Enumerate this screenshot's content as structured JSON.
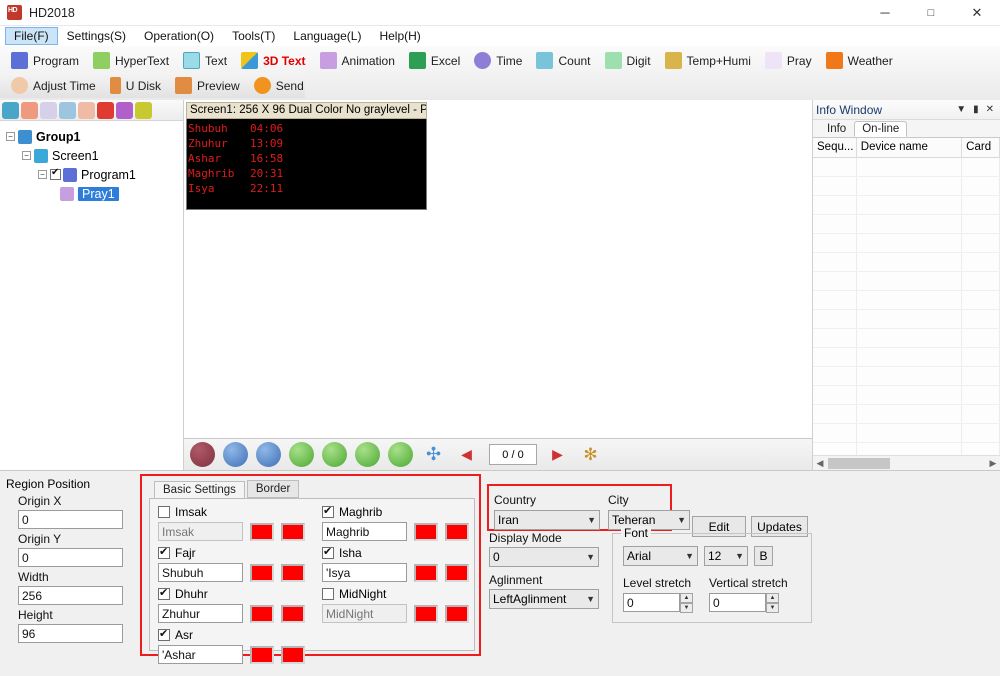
{
  "window": {
    "title": "HD2018",
    "icon": "hd-app-icon",
    "controls": {
      "minimize": "─",
      "maximize": "□",
      "close": "✕"
    }
  },
  "menubar": {
    "items": [
      {
        "label": "File(F)",
        "active": true
      },
      {
        "label": "Settings(S)",
        "active": false
      },
      {
        "label": "Operation(O)",
        "active": false
      },
      {
        "label": "Tools(T)",
        "active": false
      },
      {
        "label": "Language(L)",
        "active": false
      },
      {
        "label": "Help(H)",
        "active": false
      }
    ]
  },
  "ribbon": {
    "row1": [
      {
        "label": "Program",
        "icon": "program-icon",
        "color": "#5b6fd6",
        "red": false
      },
      {
        "label": "HyperText",
        "icon": "hypertext-icon",
        "color": "#8fcf62",
        "red": false
      },
      {
        "label": "Text",
        "icon": "text-icon",
        "color": "#4fc3d9",
        "red": false
      },
      {
        "label": "3D Text",
        "icon": "3d-text-icon",
        "color": "#f0c419",
        "red": true
      },
      {
        "label": "Animation",
        "icon": "animation-icon",
        "color": "#a06fd0",
        "red": false
      },
      {
        "label": "Excel",
        "icon": "excel-icon",
        "color": "#2e9e54",
        "red": false
      },
      {
        "label": "Time",
        "icon": "time-icon",
        "color": "#7b68c9",
        "red": false
      },
      {
        "label": "Count",
        "icon": "count-icon",
        "color": "#4fa8c0",
        "red": false
      },
      {
        "label": "Digit",
        "icon": "digit-icon",
        "color": "#73c98a",
        "red": false
      },
      {
        "label": "Temp+Humi",
        "icon": "temp-humi-icon",
        "color": "#d4a017",
        "red": false
      },
      {
        "label": "Pray",
        "icon": "pray-icon",
        "color": "#a35fd1",
        "red": false
      },
      {
        "label": "Weather",
        "icon": "weather-icon",
        "color": "#f07818",
        "red": false
      }
    ],
    "row2": [
      {
        "label": "Adjust Time",
        "icon": "adjust-time-icon",
        "color": "#e8a87c"
      },
      {
        "label": "U Disk",
        "icon": "usb-disk-icon",
        "color": "#e08c43"
      },
      {
        "label": "Preview",
        "icon": "preview-icon",
        "color": "#e08c43"
      },
      {
        "label": "Send",
        "icon": "send-icon",
        "color": "#f0941f"
      }
    ]
  },
  "tree": {
    "toolbar_icons": [
      {
        "name": "new-screen-icon",
        "color": "#3d9bbf"
      },
      {
        "name": "copy-screen-icon",
        "color": "#e88a6a"
      },
      {
        "name": "paste-icon",
        "color": "#c9c3e0"
      },
      {
        "name": "move-up-icon",
        "color": "#8fb8d8"
      },
      {
        "name": "move-down-icon",
        "color": "#e8a891"
      },
      {
        "name": "delete-icon",
        "color": "#e03b30"
      },
      {
        "name": "confirm-icon",
        "color": "#b060c8"
      },
      {
        "name": "search-icon",
        "color": "#c8c830"
      }
    ],
    "nodes": [
      {
        "label": "Group1",
        "indent": 0,
        "icon": "group-icon",
        "icon_color": "#3d8fd0",
        "expander": "-",
        "checkbox": null,
        "selected": false,
        "bold": true
      },
      {
        "label": "Screen1",
        "indent": 1,
        "icon": "screen-icon",
        "icon_color": "#3aa8d8",
        "expander": "-",
        "checkbox": null,
        "selected": false,
        "bold": false
      },
      {
        "label": "Program1",
        "indent": 2,
        "icon": "program-icon",
        "icon_color": "#5b6fd6",
        "expander": "-",
        "checkbox": true,
        "selected": false,
        "bold": false
      },
      {
        "label": "Pray1",
        "indent": 3,
        "icon": "pray-icon",
        "icon_color": "#a35fd1",
        "expander": "",
        "checkbox": null,
        "selected": true,
        "bold": false
      }
    ]
  },
  "screen_window": {
    "title": "Screen1: 256 X 96  Dual Color No graylevel - P",
    "led_color": "#e01b1b",
    "rows": [
      {
        "name": "Shubuh",
        "time": "04:06"
      },
      {
        "name": "Zhuhur",
        "time": "13:09"
      },
      {
        "name": "Ashar",
        "time": "16:58"
      },
      {
        "name": "Maghrib",
        "time": "20:31"
      },
      {
        "name": "Isya",
        "time": "22:11"
      }
    ]
  },
  "playbar": {
    "buttons": [
      {
        "name": "pause-button",
        "glyph": "‖",
        "color": "#8a3a4a"
      },
      {
        "name": "zoom-in-button",
        "glyph": "+",
        "color": "#4a7fc1"
      },
      {
        "name": "zoom-out-button",
        "glyph": "−",
        "color": "#4a7fc1"
      },
      {
        "name": "move-left-button",
        "glyph": "←",
        "color": "#5bb84a"
      },
      {
        "name": "move-right-button",
        "glyph": "→",
        "color": "#5bb84a"
      },
      {
        "name": "move-up-button",
        "glyph": "↑",
        "color": "#5bb84a"
      },
      {
        "name": "move-down-button",
        "glyph": "↓",
        "color": "#5bb84a"
      },
      {
        "name": "fit-button",
        "glyph": "✣",
        "color": "#4a90d9"
      },
      {
        "name": "prev-button",
        "glyph": "◀",
        "color": "#d03030"
      }
    ],
    "page_counter": "0 / 0",
    "next_button": {
      "name": "next-button",
      "glyph": "▶",
      "color": "#d03030"
    },
    "last_button": {
      "name": "refresh-button",
      "glyph": "✻",
      "color": "#c8922a"
    }
  },
  "info_window": {
    "title": "Info Window",
    "header_buttons": [
      "▼",
      "▮",
      "✕"
    ],
    "tabs": [
      {
        "label": "Info",
        "active": false
      },
      {
        "label": "On-line",
        "active": true
      }
    ],
    "columns": [
      "Sequ...",
      "Device name",
      "Card"
    ],
    "rows": []
  },
  "region_position": {
    "title": "Region Position",
    "fields": [
      {
        "label": "Origin X",
        "value": "0"
      },
      {
        "label": "Origin Y",
        "value": "0"
      },
      {
        "label": "Width",
        "value": "256"
      },
      {
        "label": "Height",
        "value": "96"
      }
    ]
  },
  "settings": {
    "tabs": [
      {
        "label": "Basic Settings",
        "active": true
      },
      {
        "label": "Border",
        "active": false
      }
    ],
    "prayers_left": [
      {
        "check_label": "Imsak",
        "checked": false,
        "value": "Imsak",
        "placeholder": "Imsak",
        "enabled": false,
        "color1": "#ff0000",
        "color2": "#ff0000"
      },
      {
        "check_label": "Fajr",
        "checked": true,
        "value": "Shubuh",
        "placeholder": "",
        "enabled": true,
        "color1": "#ff0000",
        "color2": "#ff0000"
      },
      {
        "check_label": "Dhuhr",
        "checked": true,
        "value": "Zhuhur",
        "placeholder": "",
        "enabled": true,
        "color1": "#ff0000",
        "color2": "#ff0000"
      },
      {
        "check_label": "Asr",
        "checked": true,
        "value": "'Ashar",
        "placeholder": "",
        "enabled": true,
        "color1": "#ff0000",
        "color2": "#ff0000"
      }
    ],
    "prayers_right": [
      {
        "check_label": "Maghrib",
        "checked": true,
        "value": "Maghrib",
        "placeholder": "",
        "enabled": true,
        "color1": "#ff0000",
        "color2": "#ff0000"
      },
      {
        "check_label": "Isha",
        "checked": true,
        "value": "'Isya",
        "placeholder": "",
        "enabled": true,
        "color1": "#ff0000",
        "color2": "#ff0000"
      },
      {
        "check_label": "MidNight",
        "checked": false,
        "value": "MidNight",
        "placeholder": "MidNight",
        "enabled": false,
        "color1": "#ff0000",
        "color2": "#ff0000"
      }
    ]
  },
  "location": {
    "country_label": "Country",
    "country_value": "Iran",
    "city_label": "City",
    "city_value": "Teheran",
    "edit_button": "Edit",
    "updates_button": "Updates"
  },
  "display": {
    "mode_label": "Display Mode",
    "mode_value": "0",
    "align_label": "Aglinment",
    "align_value": "LeftAglinment"
  },
  "font": {
    "legend": "Font",
    "family": "Arial",
    "size": "12",
    "bold_label": "B",
    "level_stretch_label": "Level stretch",
    "level_stretch_value": "0",
    "vertical_stretch_label": "Vertical stretch",
    "vertical_stretch_value": "0"
  },
  "highlights": {
    "accent": "#ee1c1c"
  }
}
